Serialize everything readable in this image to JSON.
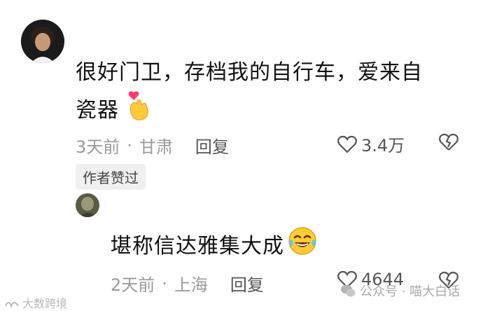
{
  "comment1": {
    "text_line1": "很好门卫，存档我的自行车，爱来自",
    "text_line2": "瓷器",
    "emoji": "finger-heart-emoji",
    "time": "3天前",
    "location": "甘肃",
    "reply_label": "回复",
    "like_count": "3.4万",
    "author_liked_badge": "作者赞过"
  },
  "reply1": {
    "text": "堪称信达雅集大成",
    "emoji": "laughing-crying-emoji",
    "time": "2天前",
    "location": "上海",
    "reply_label": "回复",
    "like_count": "4644"
  },
  "watermarks": {
    "bottom_left": "大数跨境",
    "bottom_right": "公众号 · 喵大白话"
  },
  "colors": {
    "text": "#111111",
    "meta": "#9a9a9a",
    "badge_bg": "#f0f0f0"
  }
}
